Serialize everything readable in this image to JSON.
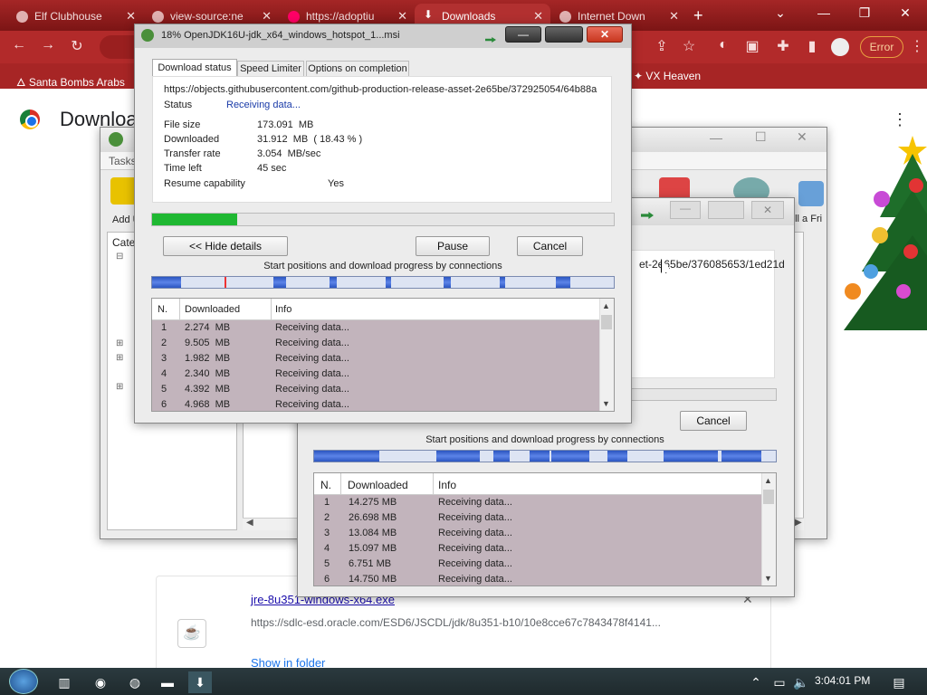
{
  "browser": {
    "tabs": [
      {
        "label": "Elf Clubhouse"
      },
      {
        "label": "view-source:ne"
      },
      {
        "label": "https://adoptiu"
      },
      {
        "label": "Downloads"
      },
      {
        "label": "Internet Down"
      }
    ],
    "error_label": "Error",
    "bookmarks": [
      {
        "label": "Santa Bombs Arabs"
      },
      {
        "label": "VX Heaven"
      }
    ]
  },
  "downloads_page": {
    "title": "Downloads",
    "item": {
      "name": "jre-8u351-windows-x64.exe",
      "url": "https://sdlc-esd.oracle.com/ESD6/JSCDL/jdk/8u351-b10/10e8cce67c7843478f4141...",
      "show_in_folder": "Show in folder"
    }
  },
  "bg_app": {
    "menu_tasks": "Tasks",
    "add_label": "Add U",
    "cate_label": "Cate",
    "friend_label": "ell a Fri"
  },
  "dialog_back": {
    "url_fragment": "et-2e65be/376085653/1ed21d",
    "cancel_label": "Cancel",
    "conn_label": "Start positions and download progress by connections",
    "columns": [
      "N.",
      "Downloaded",
      "Info"
    ],
    "rows": [
      {
        "n": "1",
        "downloaded": "14.275  MB",
        "info": "Receiving data..."
      },
      {
        "n": "2",
        "downloaded": "26.698  MB",
        "info": "Receiving data..."
      },
      {
        "n": "3",
        "downloaded": "13.084  MB",
        "info": "Receiving data..."
      },
      {
        "n": "4",
        "downloaded": "15.097  MB",
        "info": "Receiving data..."
      },
      {
        "n": "5",
        "downloaded": "6.751  MB",
        "info": "Receiving data..."
      },
      {
        "n": "6",
        "downloaded": "14.750  MB",
        "info": "Receiving data..."
      }
    ]
  },
  "dialog": {
    "title": "18% OpenJDK16U-jdk_x64_windows_hotspot_1...msi",
    "tabs": [
      "Download status",
      "Speed Limiter",
      "Options on completion"
    ],
    "url": "https://objects.githubusercontent.com/github-production-release-asset-2e65be/372925054/64b88a",
    "status_label": "Status",
    "status_value": "Receiving data...",
    "file_size_label": "File size",
    "file_size_value": "173.091  MB",
    "downloaded_label": "Downloaded",
    "downloaded_value": "31.912  MB  ( 18.43 % )",
    "transfer_label": "Transfer rate",
    "transfer_value": "3.054  MB/sec",
    "timeleft_label": "Time left",
    "timeleft_value": "45 sec",
    "resume_label": "Resume capability",
    "resume_value": "Yes",
    "progress_fraction": 0.1843,
    "hide_details": "<< Hide details",
    "pause": "Pause",
    "cancel": "Cancel",
    "conn_label": "Start positions and download progress by connections",
    "columns": [
      "N.",
      "Downloaded",
      "Info"
    ],
    "rows": [
      {
        "n": "1",
        "downloaded": "2.274  MB",
        "info": "Receiving data..."
      },
      {
        "n": "2",
        "downloaded": "9.505  MB",
        "info": "Receiving data..."
      },
      {
        "n": "3",
        "downloaded": "1.982  MB",
        "info": "Receiving data..."
      },
      {
        "n": "4",
        "downloaded": "2.340  MB",
        "info": "Receiving data..."
      },
      {
        "n": "5",
        "downloaded": "4.392  MB",
        "info": "Receiving data..."
      },
      {
        "n": "6",
        "downloaded": "4.968  MB",
        "info": "Receiving data..."
      }
    ]
  },
  "taskbar": {
    "clock": "3:04:01 PM"
  },
  "colors": {
    "progress_fill": "#1fb832",
    "browser_theme": "#a72525",
    "grid_bg": "#c2b4bc"
  }
}
